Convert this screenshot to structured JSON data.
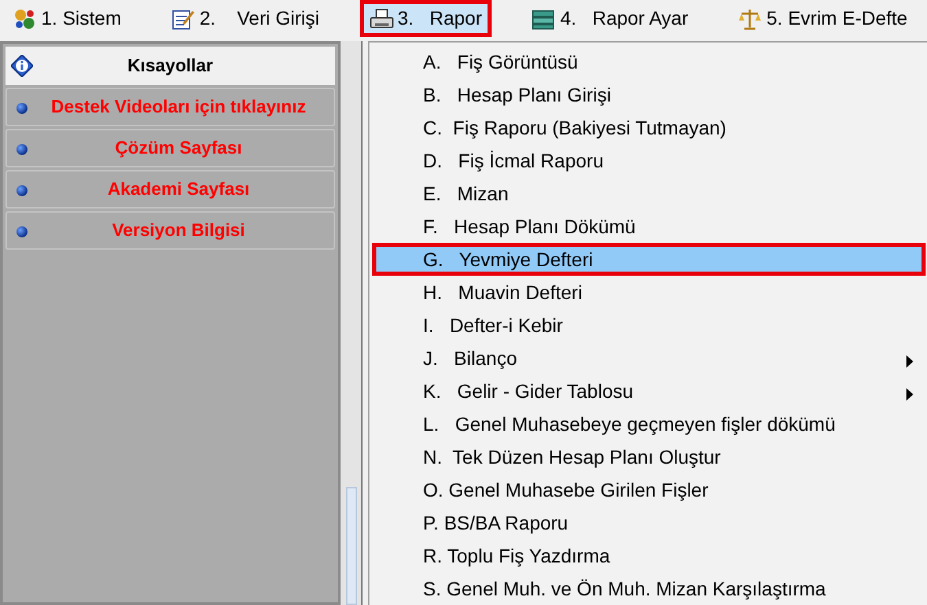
{
  "menubar": [
    {
      "label": "1. Sistem",
      "selected": false,
      "highlighted": false
    },
    {
      "label": "2.    Veri Girişi",
      "selected": false,
      "highlighted": false
    },
    {
      "label": "3.   Rapor",
      "selected": true,
      "highlighted": true
    },
    {
      "label": "4.   Rapor Ayar",
      "selected": false,
      "highlighted": false
    },
    {
      "label": "5. Evrim E-Defte",
      "selected": false,
      "highlighted": false
    }
  ],
  "shortcuts": {
    "title": "Kısayollar",
    "items": [
      "Destek Videoları için tıklayınız",
      "Çözüm Sayfası",
      "Akademi Sayfası",
      "Versiyon Bilgisi"
    ]
  },
  "dropdown": [
    {
      "label": "A.   Fiş Görüntüsü",
      "selected": false,
      "highlighted": false,
      "has_submenu": false
    },
    {
      "label": "B.   Hesap Planı Girişi",
      "selected": false,
      "highlighted": false,
      "has_submenu": false
    },
    {
      "label": "C.  Fiş Raporu (Bakiyesi Tutmayan)",
      "selected": false,
      "highlighted": false,
      "has_submenu": false
    },
    {
      "label": "D.   Fiş İcmal Raporu",
      "selected": false,
      "highlighted": false,
      "has_submenu": false
    },
    {
      "label": "E.   Mizan",
      "selected": false,
      "highlighted": false,
      "has_submenu": false
    },
    {
      "label": "F.   Hesap Planı Dökümü",
      "selected": false,
      "highlighted": false,
      "has_submenu": false
    },
    {
      "label": "G.   Yevmiye Defteri",
      "selected": true,
      "highlighted": true,
      "has_submenu": false
    },
    {
      "label": "H.   Muavin Defteri",
      "selected": false,
      "highlighted": false,
      "has_submenu": false
    },
    {
      "label": "I.   Defter-i Kebir",
      "selected": false,
      "highlighted": false,
      "has_submenu": false
    },
    {
      "label": "J.   Bilanço",
      "selected": false,
      "highlighted": false,
      "has_submenu": true
    },
    {
      "label": "K.   Gelir - Gider Tablosu",
      "selected": false,
      "highlighted": false,
      "has_submenu": true
    },
    {
      "label": "L.   Genel Muhasebeye geçmeyen fişler dökümü",
      "selected": false,
      "highlighted": false,
      "has_submenu": false
    },
    {
      "label": "N.  Tek Düzen Hesap Planı Oluştur",
      "selected": false,
      "highlighted": false,
      "has_submenu": false
    },
    {
      "label": "O. Genel Muhasebe Girilen Fişler",
      "selected": false,
      "highlighted": false,
      "has_submenu": false
    },
    {
      "label": "P. BS/BA Raporu",
      "selected": false,
      "highlighted": false,
      "has_submenu": false
    },
    {
      "label": "R. Toplu Fiş Yazdırma",
      "selected": false,
      "highlighted": false,
      "has_submenu": false
    },
    {
      "label": "S. Genel Muh. ve Ön Muh. Mizan Karşılaştırma",
      "selected": false,
      "highlighted": false,
      "has_submenu": false
    }
  ]
}
